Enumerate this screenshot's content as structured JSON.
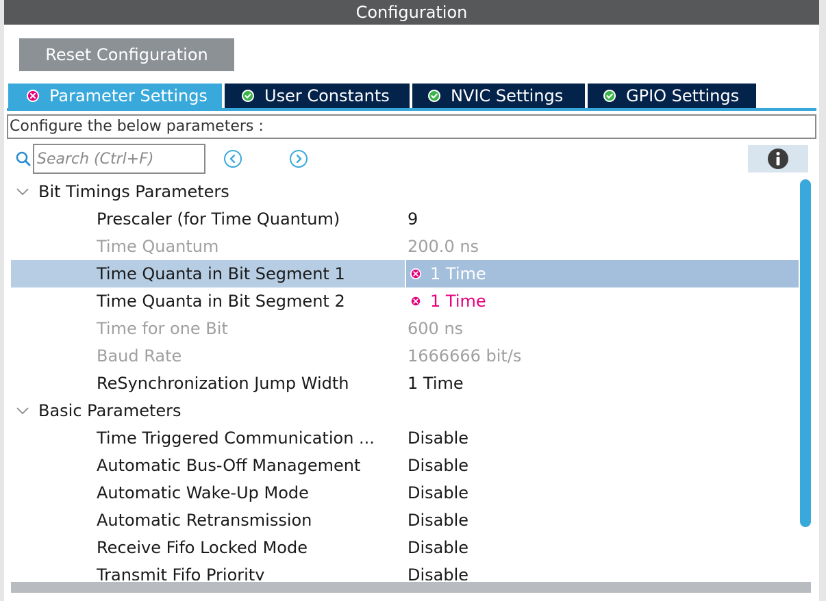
{
  "window": {
    "title": "Configuration"
  },
  "toolbar": {
    "reset_label": "Reset Configuration"
  },
  "tabs": [
    {
      "label": "Parameter Settings",
      "status": "error",
      "active": true
    },
    {
      "label": "User Constants",
      "status": "ok",
      "active": false
    },
    {
      "label": "NVIC Settings",
      "status": "ok",
      "active": false
    },
    {
      "label": "GPIO Settings",
      "status": "ok",
      "active": false
    }
  ],
  "description": "Configure the below parameters :",
  "search": {
    "placeholder": "Search (Ctrl+F)"
  },
  "icons": {
    "search": "search-icon",
    "prev": "chevron-left-circle-icon",
    "next": "chevron-right-circle-icon",
    "info": "info-icon",
    "error": "error-circle-icon",
    "ok": "check-circle-icon",
    "collapse": "chevron-down-icon"
  },
  "groups": [
    {
      "label": "Bit Timings Parameters",
      "params": [
        {
          "name": "Prescaler (for Time Quantum)",
          "value": "9",
          "state": "normal"
        },
        {
          "name": "Time Quantum",
          "value": "200.0 ns",
          "state": "disabled"
        },
        {
          "name": "Time Quanta in Bit Segment 1",
          "value": "1 Time",
          "state": "error",
          "selected": true
        },
        {
          "name": "Time Quanta in Bit Segment 2",
          "value": "1 Time",
          "state": "error"
        },
        {
          "name": "Time for one Bit",
          "value": "600 ns",
          "state": "disabled"
        },
        {
          "name": "Baud Rate",
          "value": "1666666 bit/s",
          "state": "disabled"
        },
        {
          "name": "ReSynchronization Jump Width",
          "value": "1 Time",
          "state": "normal"
        }
      ]
    },
    {
      "label": "Basic Parameters",
      "params": [
        {
          "name": "Time Triggered Communication ...",
          "value": "Disable",
          "state": "normal"
        },
        {
          "name": "Automatic Bus-Off Management",
          "value": "Disable",
          "state": "normal"
        },
        {
          "name": "Automatic Wake-Up Mode",
          "value": "Disable",
          "state": "normal"
        },
        {
          "name": "Automatic Retransmission",
          "value": "Disable",
          "state": "normal"
        },
        {
          "name": "Receive Fifo Locked Mode",
          "value": "Disable",
          "state": "normal"
        },
        {
          "name": "Transmit Fifo Priority",
          "value": "Disable",
          "state": "normal"
        }
      ]
    }
  ],
  "colors": {
    "accent": "#39a9dc",
    "tab_dark": "#03234b",
    "error": "#e6007e",
    "ok": "#3bb54a",
    "selection": "#b7cde4",
    "titlebar": "#57585a"
  }
}
